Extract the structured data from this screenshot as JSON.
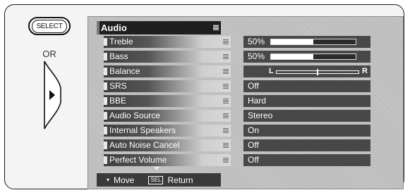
{
  "remote": {
    "select_label": "SELECT",
    "or_text": "OR"
  },
  "menu": {
    "title": "Audio",
    "rows": [
      {
        "label": "Treble",
        "value": "50%",
        "level": 0.5
      },
      {
        "label": "Bass",
        "value": "50%",
        "level": 0.5
      },
      {
        "label": "Balance",
        "left": "L",
        "right": "R",
        "position": 0.5
      },
      {
        "label": "SRS",
        "value": "Off"
      },
      {
        "label": "BBE",
        "value": "Hard"
      },
      {
        "label": "Audio Source",
        "value": "Stereo"
      },
      {
        "label": "Internal Speakers",
        "value": "On"
      },
      {
        "label": "Auto Noise Cancel",
        "value": "Off"
      },
      {
        "label": "Perfect Volume",
        "value": "Off"
      }
    ]
  },
  "footer": {
    "move_label": "Move",
    "sel_key": "SEL",
    "return_label": "Return"
  }
}
